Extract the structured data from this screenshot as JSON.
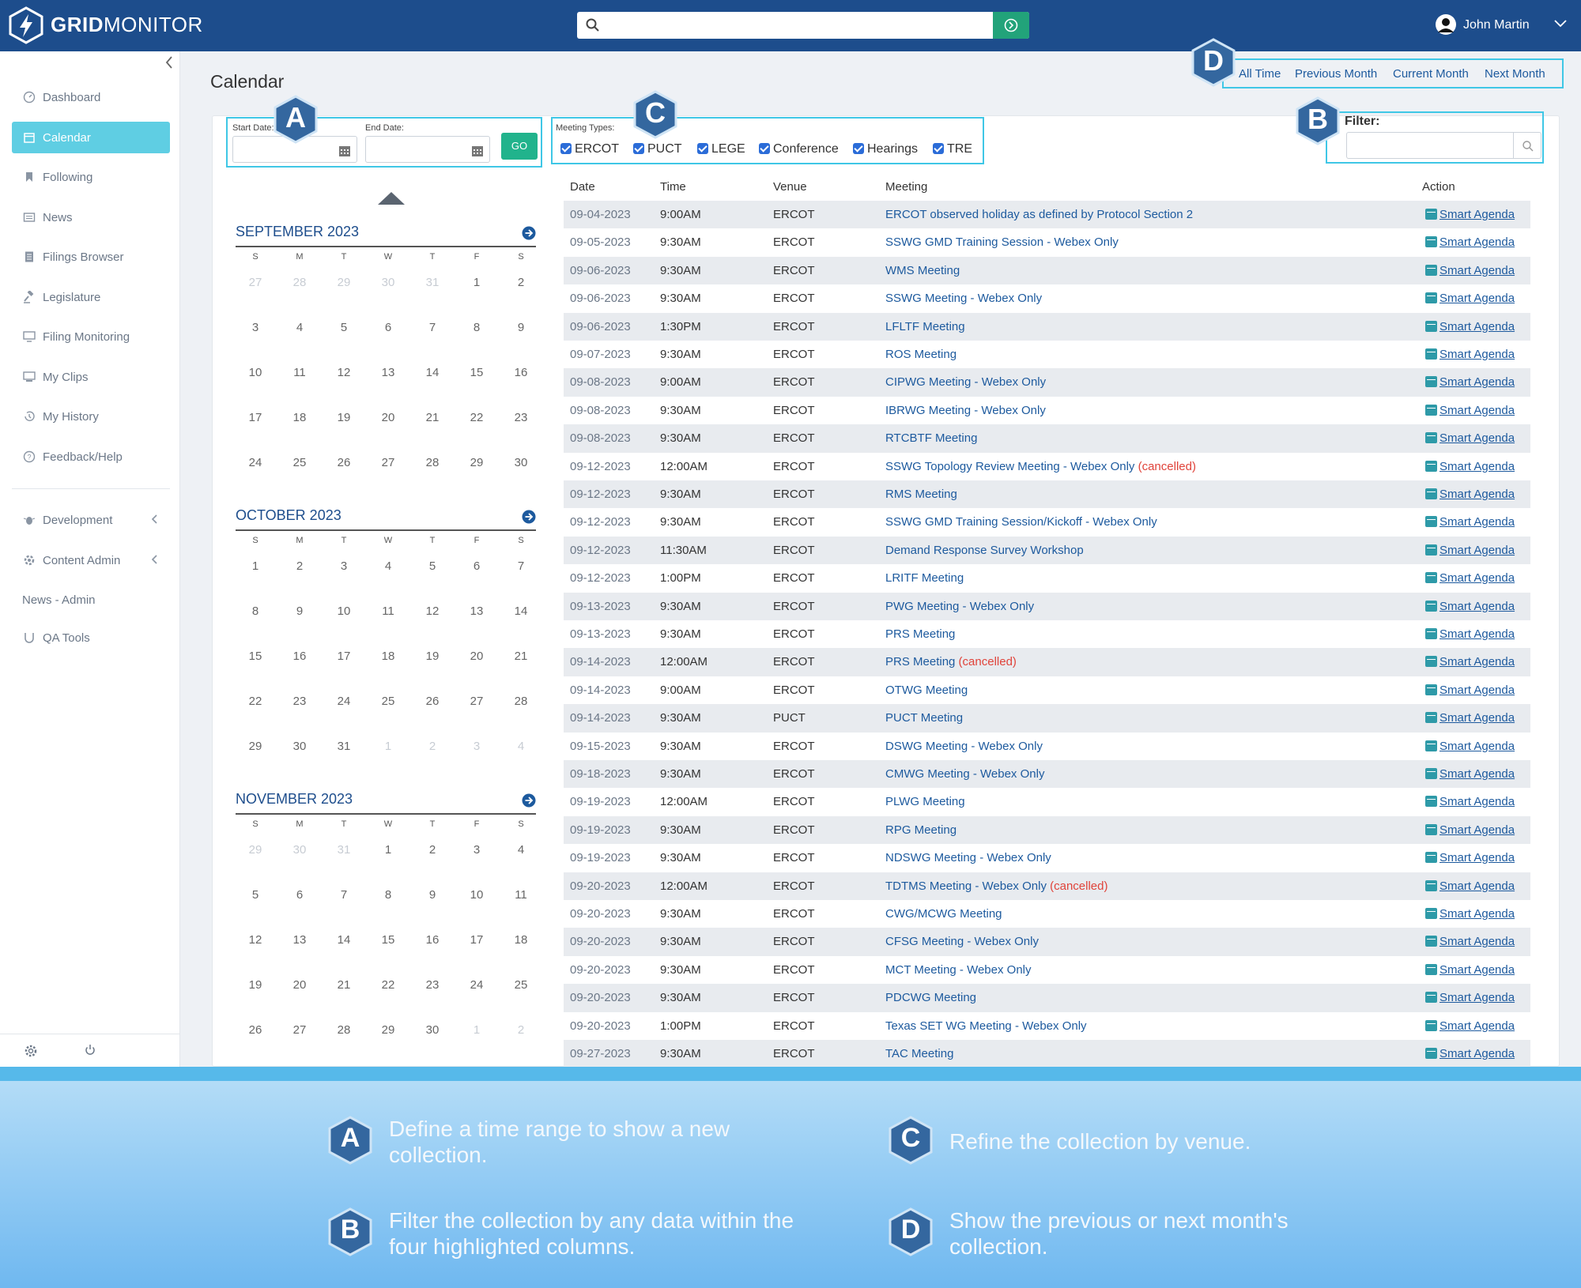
{
  "header": {
    "brand_bold": "GRID",
    "brand_light": "MONITOR",
    "search_value": "",
    "user_name": "John Martin"
  },
  "sidebar": {
    "items": [
      {
        "label": "Dashboard",
        "icon": "dashboard-icon"
      },
      {
        "label": "Calendar",
        "icon": "calendar-icon",
        "active": true
      },
      {
        "label": "Following",
        "icon": "bookmark-icon"
      },
      {
        "label": "News",
        "icon": "news-icon"
      },
      {
        "label": "Filings Browser",
        "icon": "document-icon"
      },
      {
        "label": "Legislature",
        "icon": "gavel-icon"
      },
      {
        "label": "Filing Monitoring",
        "icon": "monitor-icon"
      },
      {
        "label": "My Clips",
        "icon": "clips-icon"
      },
      {
        "label": "My History",
        "icon": "history-icon"
      },
      {
        "label": "Feedback/Help",
        "icon": "help-icon"
      }
    ],
    "admin_items": [
      {
        "label": "Development",
        "icon": "bug-icon"
      },
      {
        "label": "Content Admin",
        "icon": "admin-icon"
      },
      {
        "label": "News - Admin"
      },
      {
        "label": "QA Tools",
        "icon": "qa-icon"
      }
    ]
  },
  "page": {
    "title": "Calendar",
    "period_links": [
      "All Time",
      "Previous Month",
      "Current Month",
      "Next Month"
    ],
    "start_date_label": "Start Date:",
    "end_date_label": "End Date:",
    "start_date_value": "",
    "end_date_value": "",
    "go_label": "GO",
    "meeting_types_label": "Meeting Types:",
    "meeting_types": [
      {
        "label": "ERCOT",
        "checked": true
      },
      {
        "label": "PUCT",
        "checked": true
      },
      {
        "label": "LEGE",
        "checked": true
      },
      {
        "label": "Conference",
        "checked": true
      },
      {
        "label": "Hearings",
        "checked": true
      },
      {
        "label": "TRE",
        "checked": true
      }
    ],
    "filter_label": "Filter:",
    "filter_value": ""
  },
  "badges": {
    "a": "A",
    "b": "B",
    "c": "C",
    "d": "D"
  },
  "calendars": [
    {
      "title": "SEPTEMBER 2023",
      "dow": [
        "S",
        "M",
        "T",
        "W",
        "T",
        "F",
        "S"
      ],
      "weeks": [
        [
          "27",
          "28",
          "29",
          "30",
          "31",
          "1",
          "2"
        ],
        [
          "3",
          "4",
          "5",
          "6",
          "7",
          "8",
          "9"
        ],
        [
          "10",
          "11",
          "12",
          "13",
          "14",
          "15",
          "16"
        ],
        [
          "17",
          "18",
          "19",
          "20",
          "21",
          "22",
          "23"
        ],
        [
          "24",
          "25",
          "26",
          "27",
          "28",
          "29",
          "30"
        ]
      ],
      "other_month_mask": [
        [
          1,
          1,
          1,
          1,
          1,
          0,
          0
        ],
        [
          0,
          0,
          0,
          0,
          0,
          0,
          0
        ],
        [
          0,
          0,
          0,
          0,
          0,
          0,
          0
        ],
        [
          0,
          0,
          0,
          0,
          0,
          0,
          0
        ],
        [
          0,
          0,
          0,
          0,
          0,
          0,
          0
        ]
      ]
    },
    {
      "title": "OCTOBER 2023",
      "dow": [
        "S",
        "M",
        "T",
        "W",
        "T",
        "F",
        "S"
      ],
      "weeks": [
        [
          "1",
          "2",
          "3",
          "4",
          "5",
          "6",
          "7"
        ],
        [
          "8",
          "9",
          "10",
          "11",
          "12",
          "13",
          "14"
        ],
        [
          "15",
          "16",
          "17",
          "18",
          "19",
          "20",
          "21"
        ],
        [
          "22",
          "23",
          "24",
          "25",
          "26",
          "27",
          "28"
        ],
        [
          "29",
          "30",
          "31",
          "1",
          "2",
          "3",
          "4"
        ]
      ],
      "other_month_mask": [
        [
          0,
          0,
          0,
          0,
          0,
          0,
          0
        ],
        [
          0,
          0,
          0,
          0,
          0,
          0,
          0
        ],
        [
          0,
          0,
          0,
          0,
          0,
          0,
          0
        ],
        [
          0,
          0,
          0,
          0,
          0,
          0,
          0
        ],
        [
          0,
          0,
          0,
          1,
          1,
          1,
          1
        ]
      ]
    },
    {
      "title": "NOVEMBER 2023",
      "dow": [
        "S",
        "M",
        "T",
        "W",
        "T",
        "F",
        "S"
      ],
      "weeks": [
        [
          "29",
          "30",
          "31",
          "1",
          "2",
          "3",
          "4"
        ],
        [
          "5",
          "6",
          "7",
          "8",
          "9",
          "10",
          "11"
        ],
        [
          "12",
          "13",
          "14",
          "15",
          "16",
          "17",
          "18"
        ],
        [
          "19",
          "20",
          "21",
          "22",
          "23",
          "24",
          "25"
        ],
        [
          "26",
          "27",
          "28",
          "29",
          "30",
          "1",
          "2"
        ]
      ],
      "other_month_mask": [
        [
          1,
          1,
          1,
          0,
          0,
          0,
          0
        ],
        [
          0,
          0,
          0,
          0,
          0,
          0,
          0
        ],
        [
          0,
          0,
          0,
          0,
          0,
          0,
          0
        ],
        [
          0,
          0,
          0,
          0,
          0,
          0,
          0
        ],
        [
          0,
          0,
          0,
          0,
          0,
          1,
          1
        ]
      ]
    }
  ],
  "table": {
    "columns": [
      "Date",
      "Time",
      "Venue",
      "Meeting",
      "Action"
    ],
    "action_label": "Smart Agenda",
    "cancelled_label": "(cancelled)",
    "rows": [
      {
        "date": "09-04-2023",
        "time": "9:00AM",
        "venue": "ERCOT",
        "meeting": "ERCOT observed holiday as defined by Protocol Section 2",
        "cancelled": false
      },
      {
        "date": "09-05-2023",
        "time": "9:30AM",
        "venue": "ERCOT",
        "meeting": "SSWG GMD Training Session - Webex Only",
        "cancelled": false
      },
      {
        "date": "09-06-2023",
        "time": "9:30AM",
        "venue": "ERCOT",
        "meeting": "WMS Meeting",
        "cancelled": false
      },
      {
        "date": "09-06-2023",
        "time": "9:30AM",
        "venue": "ERCOT",
        "meeting": "SSWG Meeting - Webex Only",
        "cancelled": false
      },
      {
        "date": "09-06-2023",
        "time": "1:30PM",
        "venue": "ERCOT",
        "meeting": "LFLTF Meeting",
        "cancelled": false
      },
      {
        "date": "09-07-2023",
        "time": "9:30AM",
        "venue": "ERCOT",
        "meeting": "ROS Meeting",
        "cancelled": false
      },
      {
        "date": "09-08-2023",
        "time": "9:00AM",
        "venue": "ERCOT",
        "meeting": "CIPWG Meeting - Webex Only",
        "cancelled": false
      },
      {
        "date": "09-08-2023",
        "time": "9:30AM",
        "venue": "ERCOT",
        "meeting": "IBRWG Meeting - Webex Only",
        "cancelled": false
      },
      {
        "date": "09-08-2023",
        "time": "9:30AM",
        "venue": "ERCOT",
        "meeting": "RTCBTF Meeting",
        "cancelled": false
      },
      {
        "date": "09-12-2023",
        "time": "12:00AM",
        "venue": "ERCOT",
        "meeting": "SSWG Topology Review Meeting - Webex Only",
        "cancelled": true
      },
      {
        "date": "09-12-2023",
        "time": "9:30AM",
        "venue": "ERCOT",
        "meeting": "RMS Meeting",
        "cancelled": false
      },
      {
        "date": "09-12-2023",
        "time": "9:30AM",
        "venue": "ERCOT",
        "meeting": "SSWG GMD Training Session/Kickoff - Webex Only",
        "cancelled": false
      },
      {
        "date": "09-12-2023",
        "time": "11:30AM",
        "venue": "ERCOT",
        "meeting": "Demand Response Survey Workshop",
        "cancelled": false
      },
      {
        "date": "09-12-2023",
        "time": "1:00PM",
        "venue": "ERCOT",
        "meeting": "LRITF Meeting",
        "cancelled": false
      },
      {
        "date": "09-13-2023",
        "time": "9:30AM",
        "venue": "ERCOT",
        "meeting": "PWG Meeting - Webex Only",
        "cancelled": false
      },
      {
        "date": "09-13-2023",
        "time": "9:30AM",
        "venue": "ERCOT",
        "meeting": "PRS Meeting",
        "cancelled": false
      },
      {
        "date": "09-14-2023",
        "time": "12:00AM",
        "venue": "ERCOT",
        "meeting": "PRS Meeting",
        "cancelled": true
      },
      {
        "date": "09-14-2023",
        "time": "9:00AM",
        "venue": "ERCOT",
        "meeting": "OTWG Meeting",
        "cancelled": false
      },
      {
        "date": "09-14-2023",
        "time": "9:30AM",
        "venue": "PUCT",
        "meeting": "PUCT Meeting",
        "cancelled": false
      },
      {
        "date": "09-15-2023",
        "time": "9:30AM",
        "venue": "ERCOT",
        "meeting": "DSWG Meeting - Webex Only",
        "cancelled": false
      },
      {
        "date": "09-18-2023",
        "time": "9:30AM",
        "venue": "ERCOT",
        "meeting": "CMWG Meeting - Webex Only",
        "cancelled": false
      },
      {
        "date": "09-19-2023",
        "time": "12:00AM",
        "venue": "ERCOT",
        "meeting": "PLWG Meeting",
        "cancelled": false
      },
      {
        "date": "09-19-2023",
        "time": "9:30AM",
        "venue": "ERCOT",
        "meeting": "RPG Meeting",
        "cancelled": false
      },
      {
        "date": "09-19-2023",
        "time": "9:30AM",
        "venue": "ERCOT",
        "meeting": "NDSWG Meeting - Webex Only",
        "cancelled": false
      },
      {
        "date": "09-20-2023",
        "time": "12:00AM",
        "venue": "ERCOT",
        "meeting": "TDTMS Meeting - Webex Only",
        "cancelled": true
      },
      {
        "date": "09-20-2023",
        "time": "9:30AM",
        "venue": "ERCOT",
        "meeting": "CWG/MCWG Meeting",
        "cancelled": false
      },
      {
        "date": "09-20-2023",
        "time": "9:30AM",
        "venue": "ERCOT",
        "meeting": "CFSG Meeting - Webex Only",
        "cancelled": false
      },
      {
        "date": "09-20-2023",
        "time": "9:30AM",
        "venue": "ERCOT",
        "meeting": "MCT Meeting - Webex Only",
        "cancelled": false
      },
      {
        "date": "09-20-2023",
        "time": "9:30AM",
        "venue": "ERCOT",
        "meeting": "PDCWG Meeting",
        "cancelled": false
      },
      {
        "date": "09-20-2023",
        "time": "1:00PM",
        "venue": "ERCOT",
        "meeting": "Texas SET WG Meeting - Webex Only",
        "cancelled": false
      },
      {
        "date": "09-27-2023",
        "time": "9:30AM",
        "venue": "ERCOT",
        "meeting": "TAC Meeting",
        "cancelled": false
      }
    ]
  },
  "legend": [
    {
      "badge": "A",
      "text": "Define a time range to show a new collection."
    },
    {
      "badge": "C",
      "text": "Refine the collection by venue."
    },
    {
      "badge": "B",
      "text": "Filter the collection by any data within the four highlighted columns."
    },
    {
      "badge": "D",
      "text": "Show the previous or next month's collection."
    }
  ],
  "colors": {
    "header": "#1d4d8c",
    "active": "#5fcee3",
    "go": "#21b38c",
    "highlight": "#3fc7e6",
    "link": "#1d5a9e",
    "cancelled": "#e0433a"
  }
}
